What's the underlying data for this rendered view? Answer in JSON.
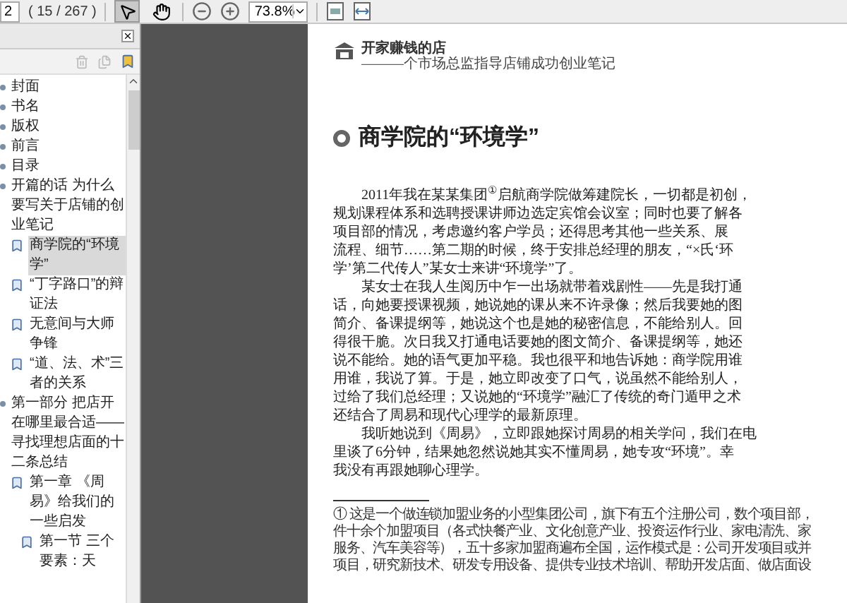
{
  "toolbar": {
    "page_field": "2",
    "page_count": "( 15 / 267 )",
    "tools": [
      {
        "kind": "select",
        "selected": true
      },
      {
        "kind": "hand",
        "selected": false
      }
    ],
    "zoom_field": "73.8%"
  },
  "bookmarks_panel": {
    "items": [
      {
        "label": "封面",
        "selected": false
      },
      {
        "label": "书名",
        "selected": false
      },
      {
        "label": "版权",
        "selected": false
      },
      {
        "label": "前言",
        "selected": false
      },
      {
        "label": "目录",
        "selected": false
      },
      {
        "label": "开篇的话 为什么要写关于店铺的创业笔记",
        "selected": false,
        "children": [
          {
            "label": "商学院的“环境学”",
            "selected": true
          },
          {
            "label": "“丁字路口”的辩证法",
            "selected": false
          },
          {
            "label": "无意间与大师争锋",
            "selected": false
          },
          {
            "label": "“道、法、术”三者的关系",
            "selected": false
          }
        ]
      },
      {
        "label": "第一部分 把店开在哪里最合适——寻找理想店面的十二条总结",
        "selected": false,
        "children": [
          {
            "label": "第一章 《周易》给我们的一些启发",
            "selected": false,
            "children": [
              {
                "label": "第一节 三个要素：天",
                "selected": false
              }
            ]
          }
        ]
      }
    ]
  },
  "page": {
    "running_head": {
      "title": "开家赚钱的店",
      "subtitle": "———个市场总监指导店铺成功创业笔记"
    },
    "section_title": "商学院的“环境学”",
    "paragraphs": [
      [
        "2011年我在某某集团$^{①}$启航商学院做筹建院长，一切都是初创，",
        "规划课程体系和选聘授课讲师边选定宾馆会议室；同时也要了解各",
        "项目部的情况，考虑邀约客户学员；还得思考其他一些关系、展",
        "流程、细节……第二期的时候，终于安排总经理的朋友，“×氏‘环",
        "学’第二代传人”某女士来讲“环境学”了。"
      ],
      [
        "某女士在我人生阅历中乍一出场就带着戏剧性——先是我打通",
        "话，向她要授课视频，她说她的课从来不许录像；然后我要她的图",
        "简介、备课提纲等，她说这个也是她的秘密信息，不能给别人。回",
        "得很干脆。次日我又打通电话要她的图文简介、备课提纲等，她还",
        "说不能给。她的语气更加平稳。我也很平和地告诉她：商学院用谁",
        "用谁，我说了算。于是，她立即改变了口气，说虽然不能给别人，",
        "过给了我们总经理；又说她的“环境学”融汇了传统的奇门遁甲之术",
        "还结合了周易和现代心理学的最新原理。"
      ],
      [
        "我听她说到《周易》，立即跟她探讨周易的相关学问，我们在电",
        "里谈了6分钟，结果她忽然说她其实不懂周易，她专攻“环境”。幸",
        "我没有再跟她聊心理学。"
      ]
    ],
    "footnote_lines": [
      "① 这是一个做连锁加盟业务的小型集团公司，旗下有五个注册公司，数个项目部，",
      "件十余个加盟项目（各式快餐产业、文化创意产业、投资运作行业、家电清洗、家",
      "服务、汽车美容等），五十多家加盟商遍布全国，运作模式是：公司开发项目或并",
      "项目，研究新技术、研发专用设备、提供专业技术培训、帮助开发店面、做店面设"
    ]
  }
}
